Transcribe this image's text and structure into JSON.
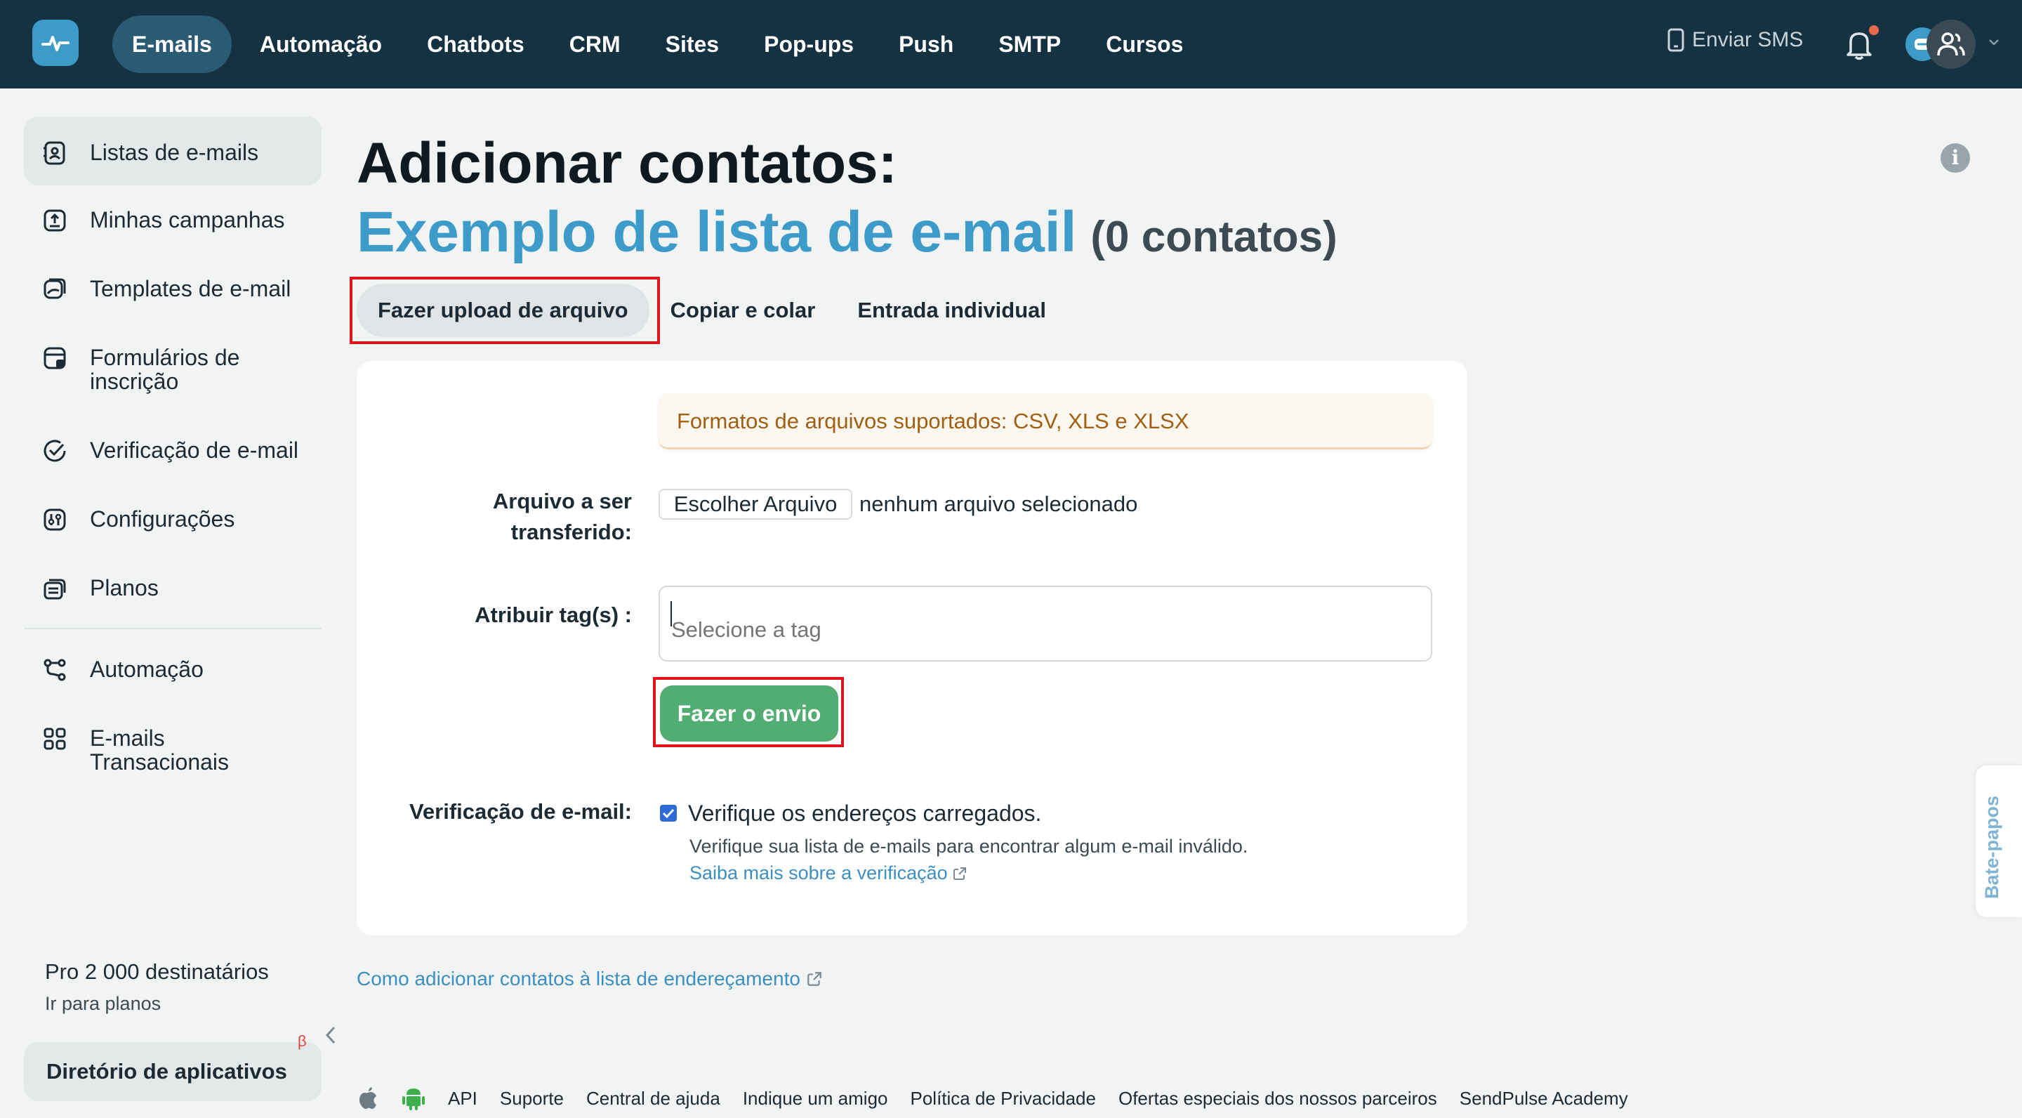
{
  "topbar": {
    "nav": [
      "E-mails",
      "Automação",
      "Chatbots",
      "CRM",
      "Sites",
      "Pop-ups",
      "Push",
      "SMTP",
      "Cursos"
    ],
    "active_index": 0,
    "sms_label": "Enviar SMS"
  },
  "sidebar": {
    "items": [
      {
        "label": "Listas de e-mails",
        "icon": "contacts-list-icon",
        "active": true
      },
      {
        "label": "Minhas campanhas",
        "icon": "upload-box-icon"
      },
      {
        "label": "Templates de e-mail",
        "icon": "template-icon"
      },
      {
        "label": "Formulários de inscrição",
        "icon": "form-icon"
      },
      {
        "label": "Verificação de e-mail",
        "icon": "check-circle-icon"
      },
      {
        "label": "Configurações",
        "icon": "settings-sliders-icon"
      },
      {
        "label": "Planos",
        "icon": "plans-icon"
      },
      {
        "label": "Automação",
        "icon": "automation-icon"
      },
      {
        "label": "E-mails Transacionais",
        "icon": "grid-icon"
      }
    ],
    "pro_title": "Pro 2 000 destinatários",
    "pro_link": "Ir para planos",
    "app_directory": "Diretório de aplicativos",
    "beta": "β"
  },
  "page": {
    "title": "Adicionar contatos:",
    "list_name": "Exemplo de lista de e-mail",
    "contact_count": "(0 contatos)"
  },
  "tabs": [
    "Fazer upload de arquivo",
    "Copiar e colar",
    "Entrada individual"
  ],
  "form": {
    "notice": "Formatos de arquivos suportados: CSV, XLS e XLSX",
    "file_label_1": "Arquivo a ser",
    "file_label_2": "transferido:",
    "file_button": "Escolher Arquivo",
    "file_status": "nenhum arquivo selecionado",
    "tag_label": "Atribuir tag(s) :",
    "tag_placeholder": "Selecione a tag",
    "submit": "Fazer o envio",
    "verify_label": "Verificação de e-mail:",
    "verify_checked": true,
    "verify_text": "Verifique os endereços carregados.",
    "verify_help": "Verifique sua lista de e-mails para encontrar algum e-mail inválido.",
    "verify_link": "Saiba mais sobre a verificação"
  },
  "how_link": "Como adicionar contatos à lista de endereçamento",
  "footer": [
    "API",
    "Suporte",
    "Central de ajuda",
    "Indique um amigo",
    "Política de Privacidade",
    "Ofertas especiais dos nossos parceiros",
    "SendPulse Academy"
  ],
  "chat_tab": "Bate-papos",
  "colors": {
    "topbar": "#153243",
    "accent": "#3d9bc9",
    "submit": "#52ad72",
    "highlight": "#e1141e"
  }
}
